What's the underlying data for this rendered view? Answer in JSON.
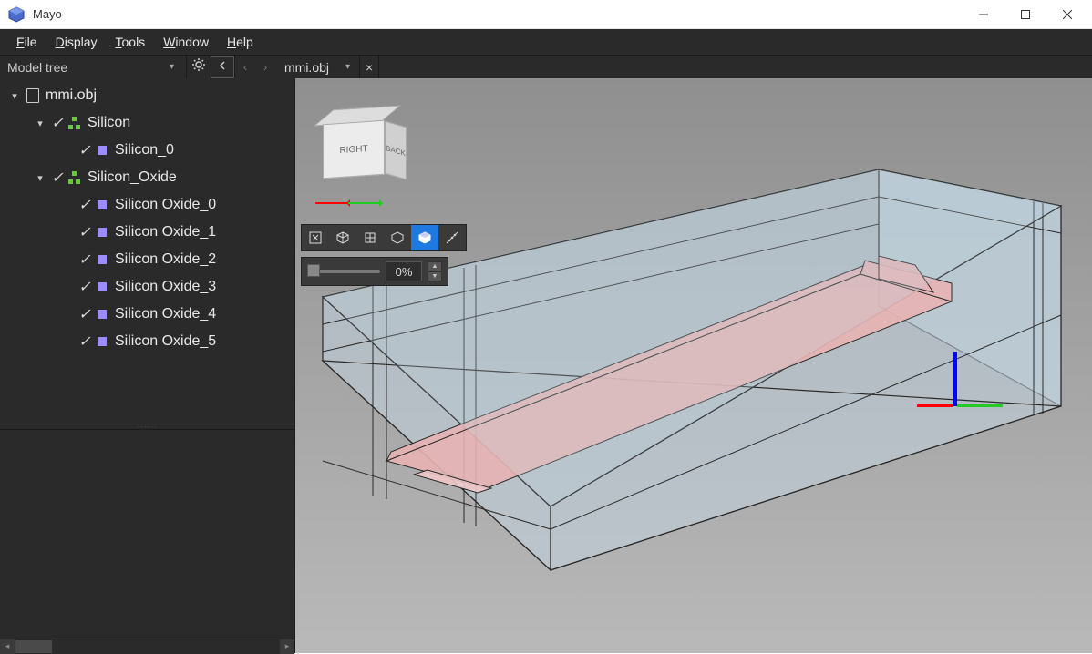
{
  "app": {
    "title": "Mayo"
  },
  "menubar": {
    "items": [
      {
        "label": "File",
        "underline": "F"
      },
      {
        "label": "Display",
        "underline": "D"
      },
      {
        "label": "Tools",
        "underline": "T"
      },
      {
        "label": "Window",
        "underline": "W"
      },
      {
        "label": "Help",
        "underline": "H"
      }
    ]
  },
  "model_tree": {
    "title": "Model tree",
    "root": {
      "label": "mmi.obj",
      "expanded": true,
      "children": [
        {
          "label": "Silicon",
          "expanded": true,
          "checked": true,
          "type": "group",
          "children": [
            {
              "label": "Silicon_0",
              "checked": true,
              "type": "mesh"
            }
          ]
        },
        {
          "label": "Silicon_Oxide",
          "expanded": true,
          "checked": true,
          "type": "group",
          "children": [
            {
              "label": "Silicon Oxide_0",
              "checked": true,
              "type": "mesh"
            },
            {
              "label": "Silicon Oxide_1",
              "checked": true,
              "type": "mesh"
            },
            {
              "label": "Silicon Oxide_2",
              "checked": true,
              "type": "mesh"
            },
            {
              "label": "Silicon Oxide_3",
              "checked": true,
              "type": "mesh"
            },
            {
              "label": "Silicon Oxide_4",
              "checked": true,
              "type": "mesh"
            },
            {
              "label": "Silicon Oxide_5",
              "checked": true,
              "type": "mesh"
            }
          ]
        }
      ]
    }
  },
  "document_tab": {
    "label": "mmi.obj"
  },
  "navcube": {
    "front": "RIGHT",
    "side": "BACK"
  },
  "explode": {
    "percent": "0%"
  },
  "viewtools": [
    {
      "name": "fit-view",
      "active": false
    },
    {
      "name": "iso-view",
      "active": false
    },
    {
      "name": "grid-view",
      "active": false
    },
    {
      "name": "wire-view",
      "active": false
    },
    {
      "name": "shaded-view",
      "active": true
    },
    {
      "name": "measure",
      "active": false
    }
  ],
  "colors": {
    "silicon": "#e8b3b3",
    "oxide": "#c1d4de",
    "edge": "#2a2a2a",
    "accent": "#1e7ae0"
  }
}
